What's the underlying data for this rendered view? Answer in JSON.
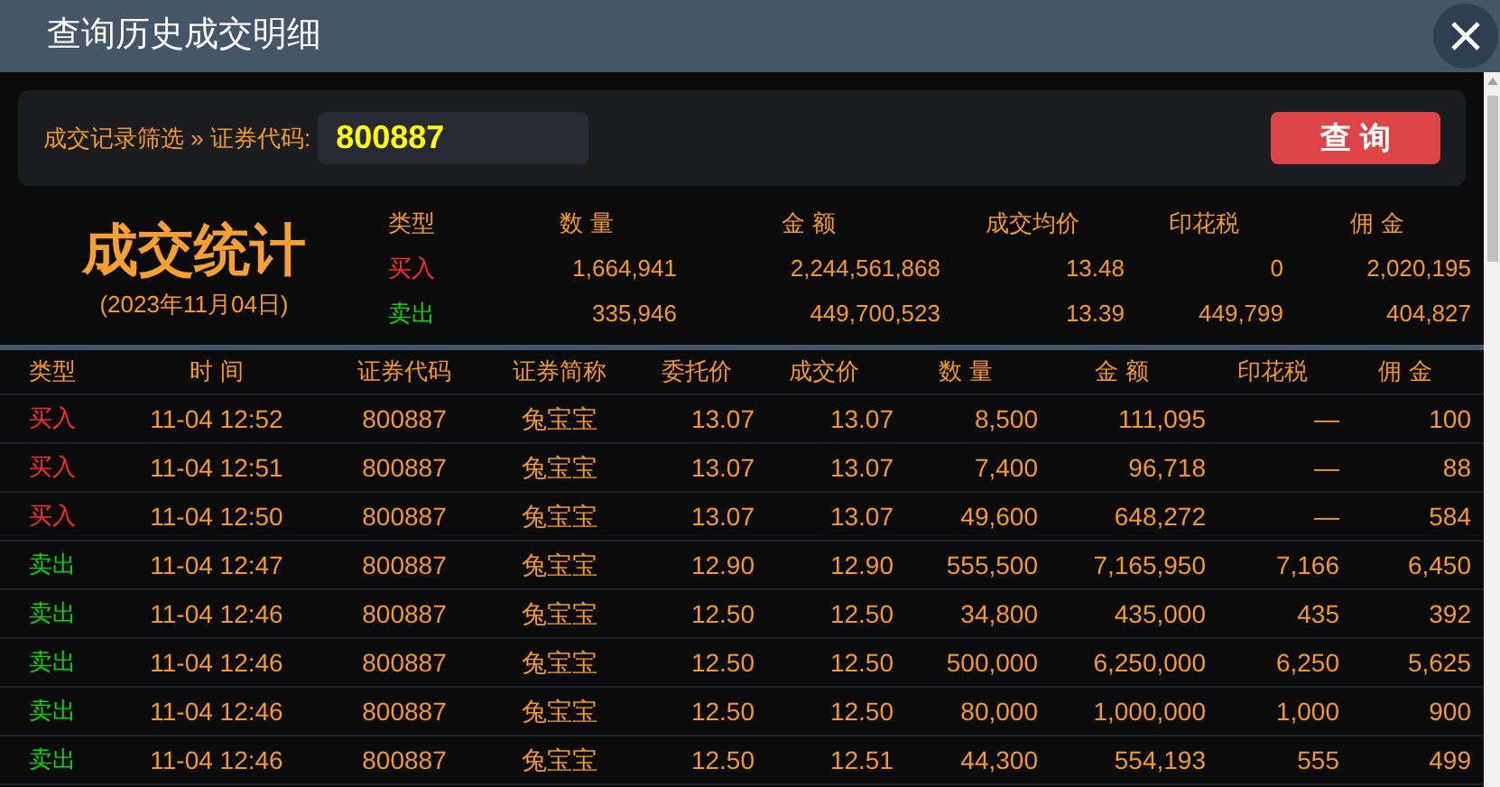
{
  "window": {
    "title": "查询历史成交明细"
  },
  "filter": {
    "label": "成交记录筛选 » 证券代码:",
    "code": "800887",
    "button": "查 询"
  },
  "summary": {
    "title": "成交统计",
    "date": "(2023年11月04日)",
    "columns": [
      "类型",
      "数 量",
      "金 额",
      "成交均价",
      "印花税",
      "佣 金"
    ],
    "rows": [
      {
        "kind": "buy",
        "cells": [
          "买入",
          "1,664,941",
          "2,244,561,868",
          "13.48",
          "0",
          "2,020,195"
        ]
      },
      {
        "kind": "sell",
        "cells": [
          "卖出",
          "335,946",
          "449,700,523",
          "13.39",
          "449,799",
          "404,827"
        ]
      }
    ]
  },
  "table": {
    "columns": [
      "类型",
      "时 间",
      "证券代码",
      "证券简称",
      "委托价",
      "成交价",
      "数 量",
      "金 额",
      "印花税",
      "佣 金"
    ],
    "rows": [
      {
        "kind": "buy",
        "cells": [
          "买入",
          "11-04 12:52",
          "800887",
          "兔宝宝",
          "13.07",
          "13.07",
          "8,500",
          "111,095",
          "—",
          "100"
        ]
      },
      {
        "kind": "buy",
        "cells": [
          "买入",
          "11-04 12:51",
          "800887",
          "兔宝宝",
          "13.07",
          "13.07",
          "7,400",
          "96,718",
          "—",
          "88"
        ]
      },
      {
        "kind": "buy",
        "cells": [
          "买入",
          "11-04 12:50",
          "800887",
          "兔宝宝",
          "13.07",
          "13.07",
          "49,600",
          "648,272",
          "—",
          "584"
        ]
      },
      {
        "kind": "sell",
        "cells": [
          "卖出",
          "11-04 12:47",
          "800887",
          "兔宝宝",
          "12.90",
          "12.90",
          "555,500",
          "7,165,950",
          "7,166",
          "6,450"
        ]
      },
      {
        "kind": "sell",
        "cells": [
          "卖出",
          "11-04 12:46",
          "800887",
          "兔宝宝",
          "12.50",
          "12.50",
          "34,800",
          "435,000",
          "435",
          "392"
        ]
      },
      {
        "kind": "sell",
        "cells": [
          "卖出",
          "11-04 12:46",
          "800887",
          "兔宝宝",
          "12.50",
          "12.50",
          "500,000",
          "6,250,000",
          "6,250",
          "5,625"
        ]
      },
      {
        "kind": "sell",
        "cells": [
          "卖出",
          "11-04 12:46",
          "800887",
          "兔宝宝",
          "12.50",
          "12.50",
          "80,000",
          "1,000,000",
          "1,000",
          "900"
        ]
      },
      {
        "kind": "sell",
        "cells": [
          "卖出",
          "11-04 12:46",
          "800887",
          "兔宝宝",
          "12.50",
          "12.51",
          "44,300",
          "554,193",
          "555",
          "499"
        ]
      }
    ]
  }
}
